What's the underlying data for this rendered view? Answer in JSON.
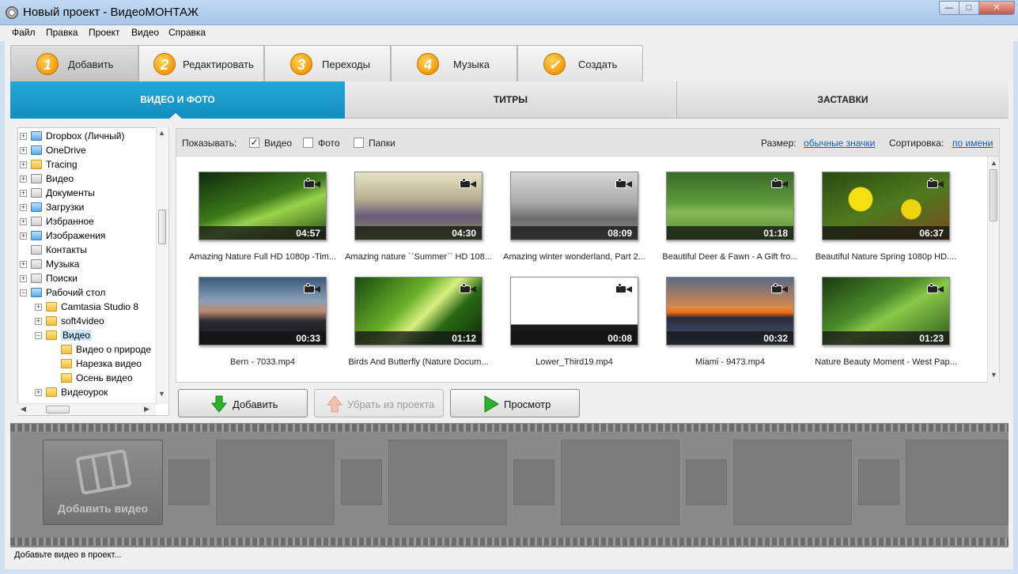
{
  "window": {
    "title": "Новый проект - ВидеоМОНТАЖ",
    "min": "—",
    "max": "□",
    "close": "✕"
  },
  "menu": [
    "Файл",
    "Правка",
    "Проект",
    "Видео",
    "Справка"
  ],
  "steps": [
    {
      "num": "1",
      "label": "Добавить"
    },
    {
      "num": "2",
      "label": "Редактировать"
    },
    {
      "num": "3",
      "label": "Переходы"
    },
    {
      "num": "4",
      "label": "Музыка"
    },
    {
      "num": "✓",
      "label": "Создать"
    }
  ],
  "subtabs": [
    "ВИДЕО И ФОТО",
    "ТИТРЫ",
    "ЗАСТАВКИ"
  ],
  "tree": [
    {
      "label": "Dropbox (Личный)",
      "icon": "dropbox-icon"
    },
    {
      "label": "OneDrive",
      "icon": "onedrive-icon"
    },
    {
      "label": "Tracing",
      "icon": "folder-icon"
    },
    {
      "label": "Видео",
      "icon": "video-library-icon"
    },
    {
      "label": "Документы",
      "icon": "documents-icon"
    },
    {
      "label": "Загрузки",
      "icon": "downloads-icon"
    },
    {
      "label": "Избранное",
      "icon": "favorites-icon"
    },
    {
      "label": "Изображения",
      "icon": "pictures-icon"
    },
    {
      "label": "Контакты",
      "icon": "contacts-icon"
    },
    {
      "label": "Музыка",
      "icon": "music-icon"
    },
    {
      "label": "Поиски",
      "icon": "searches-icon"
    },
    {
      "label": "Рабочий стол",
      "icon": "desktop-icon"
    },
    {
      "label": "Camtasia Studio 8",
      "icon": "folder-icon"
    },
    {
      "label": "soft4video",
      "icon": "folder-icon"
    },
    {
      "label": "Видео",
      "icon": "folder-icon"
    },
    {
      "label": "Видео о природе",
      "icon": "folder-icon"
    },
    {
      "label": "Нарезка видео",
      "icon": "folder-icon"
    },
    {
      "label": "Осень видео",
      "icon": "folder-icon"
    },
    {
      "label": "Видеоурок",
      "icon": "folder-icon"
    }
  ],
  "filter": {
    "show_label": "Показывать:",
    "video_label": "Видео",
    "video_checked": true,
    "photo_label": "Фото",
    "photo_checked": false,
    "folders_label": "Папки",
    "folders_checked": false,
    "size_label": "Размер:",
    "size_value": "обычные значки",
    "sort_label": "Сортировка:",
    "sort_value": "по имени"
  },
  "videos": [
    {
      "caption": "Amazing Nature Full HD 1080p -Tim...",
      "duration": "04:57",
      "palette": "linear-gradient(160deg,#0f2a0c,#3d7a1a 45%,#9ad34a 60%,#1f4a10)"
    },
    {
      "caption": "Amazing nature ``Summer`` HD 108...",
      "duration": "04:30",
      "palette": "linear-gradient(180deg,#e8e2c8,#b8b08e 40%,#6a5a7c 65%,#8a9a4a)"
    },
    {
      "caption": "Amazing winter wonderland, Part 2...",
      "duration": "08:09",
      "palette": "linear-gradient(180deg,#d9d9d9,#a9a9a9 45%,#6a6a6a 70%,#9c9c9c)"
    },
    {
      "caption": "Beautiful Deer & Fawn - A Gift fro...",
      "duration": "01:18",
      "palette": "linear-gradient(180deg,#3c6a2a,#5e9a3a 45%,#87b85a 60%,#4e8a2c)"
    },
    {
      "caption": "Beautiful Nature Spring 1080p HD....",
      "duration": "06:37",
      "palette": "radial-gradient(circle at 30% 40%,#f4e010 0 12%,transparent 13%),radial-gradient(circle at 70% 55%,#f0d410 0 10%,transparent 11%),linear-gradient(160deg,#2a4a12,#4e7a1e 50%,#7a4a1e)"
    },
    {
      "caption": "Bern - 7033.mp4",
      "duration": "00:33",
      "palette": "linear-gradient(180deg,#3a5a7a,#8aa0b8 35%,#c08a70 50%,#2a2a30 65%,#151518)"
    },
    {
      "caption": "Birds And Butterfly (Nature Docum...",
      "duration": "01:12",
      "palette": "linear-gradient(135deg,#1a4a10,#6ab02a 40%,#d8f080 55%,#2a6a14 70%,#0c2a08)"
    },
    {
      "caption": "Lower_Third19.mp4",
      "duration": "00:08",
      "palette": "linear-gradient(180deg,#ffffff 0 70%,#1a1a1a 70%)"
    },
    {
      "caption": "Miami - 9473.mp4",
      "duration": "00:32",
      "palette": "linear-gradient(180deg,#5a6a8a,#d88a4a 45%,#f06a10 52%,#2a2a3a 60%,#4a5a7a)"
    },
    {
      "caption": "Nature Beauty Moment - West Pap...",
      "duration": "01:23",
      "palette": "linear-gradient(150deg,#1a3a10,#4a8a2a 40%,#8ac84a 55%,#2a5a18)"
    }
  ],
  "buttons": {
    "add": "Добавить",
    "remove": "Убрать из проекта",
    "preview": "Просмотр"
  },
  "timeline": {
    "add_video": "Добавить видео"
  },
  "status": "Добавьте видео в проект..."
}
